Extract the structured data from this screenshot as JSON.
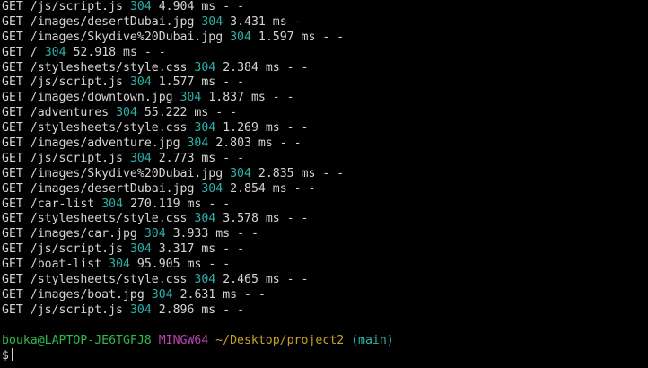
{
  "log": [
    {
      "method": "GET",
      "path": "/js/script.js",
      "status": "304",
      "time": "4.904 ms - -"
    },
    {
      "method": "GET",
      "path": "/images/desertDubai.jpg",
      "status": "304",
      "time": "3.431 ms - -"
    },
    {
      "method": "GET",
      "path": "/images/Skydive%20Dubai.jpg",
      "status": "304",
      "time": "1.597 ms - -"
    },
    {
      "method": "GET",
      "path": "/",
      "status": "304",
      "time": "52.918 ms - -"
    },
    {
      "method": "GET",
      "path": "/stylesheets/style.css",
      "status": "304",
      "time": "2.384 ms - -"
    },
    {
      "method": "GET",
      "path": "/js/script.js",
      "status": "304",
      "time": "1.577 ms - -"
    },
    {
      "method": "GET",
      "path": "/images/downtown.jpg",
      "status": "304",
      "time": "1.837 ms - -"
    },
    {
      "method": "GET",
      "path": "/adventures",
      "status": "304",
      "time": "55.222 ms - -"
    },
    {
      "method": "GET",
      "path": "/stylesheets/style.css",
      "status": "304",
      "time": "1.269 ms - -"
    },
    {
      "method": "GET",
      "path": "/images/adventure.jpg",
      "status": "304",
      "time": "2.803 ms - -"
    },
    {
      "method": "GET",
      "path": "/js/script.js",
      "status": "304",
      "time": "2.773 ms - -"
    },
    {
      "method": "GET",
      "path": "/images/Skydive%20Dubai.jpg",
      "status": "304",
      "time": "2.835 ms - -"
    },
    {
      "method": "GET",
      "path": "/images/desertDubai.jpg",
      "status": "304",
      "time": "2.854 ms - -"
    },
    {
      "method": "GET",
      "path": "/car-list",
      "status": "304",
      "time": "270.119 ms - -"
    },
    {
      "method": "GET",
      "path": "/stylesheets/style.css",
      "status": "304",
      "time": "3.578 ms - -"
    },
    {
      "method": "GET",
      "path": "/images/car.jpg",
      "status": "304",
      "time": "3.933 ms - -"
    },
    {
      "method": "GET",
      "path": "/js/script.js",
      "status": "304",
      "time": "3.317 ms - -"
    },
    {
      "method": "GET",
      "path": "/boat-list",
      "status": "304",
      "time": "95.905 ms - -"
    },
    {
      "method": "GET",
      "path": "/stylesheets/style.css",
      "status": "304",
      "time": "2.465 ms - -"
    },
    {
      "method": "GET",
      "path": "/images/boat.jpg",
      "status": "304",
      "time": "2.631 ms - -"
    },
    {
      "method": "GET",
      "path": "/js/script.js",
      "status": "304",
      "time": "2.896 ms - -"
    }
  ],
  "prompt": {
    "user_host": "bouka@LAPTOP-JE6TGFJ8",
    "env": "MINGW64",
    "cwd": "~/Desktop/project2",
    "branch": "(main)",
    "symbol": "$"
  },
  "colors": {
    "background": "#000000",
    "text": "#d4d4d4",
    "status": "#2bb0a8",
    "user_host": "#2fb94a",
    "env": "#b944b0",
    "cwd": "#c7a225",
    "branch": "#2bb0a8"
  }
}
